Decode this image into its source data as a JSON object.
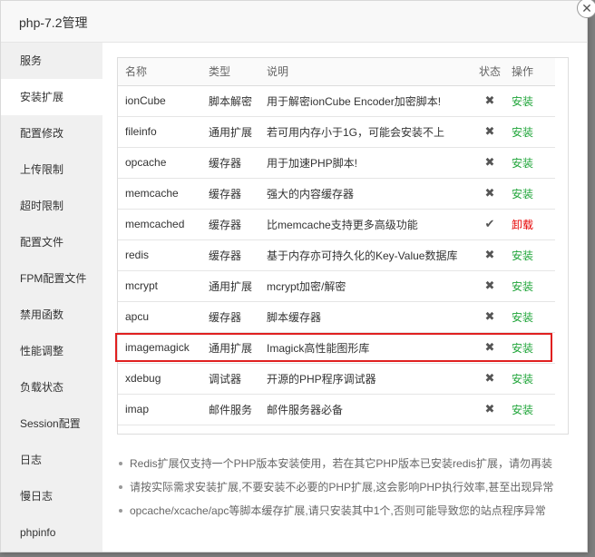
{
  "dialog": {
    "title": "php-7.2管理",
    "close_glyph": "✕"
  },
  "sidebar": {
    "items": [
      {
        "label": "服务"
      },
      {
        "label": "安装扩展",
        "active": true
      },
      {
        "label": "配置修改"
      },
      {
        "label": "上传限制"
      },
      {
        "label": "超时限制"
      },
      {
        "label": "配置文件"
      },
      {
        "label": "FPM配置文件"
      },
      {
        "label": "禁用函数"
      },
      {
        "label": "性能调整"
      },
      {
        "label": "负载状态"
      },
      {
        "label": "Session配置"
      },
      {
        "label": "日志"
      },
      {
        "label": "慢日志"
      },
      {
        "label": "phpinfo"
      }
    ]
  },
  "table": {
    "headers": {
      "name": "名称",
      "type": "类型",
      "desc": "说明",
      "status": "状态",
      "op": "操作"
    },
    "rows": [
      {
        "name": "ionCube",
        "type": "脚本解密",
        "desc": "用于解密ionCube Encoder加密脚本!",
        "status": "✖",
        "op": "安装",
        "installed": false
      },
      {
        "name": "fileinfo",
        "type": "通用扩展",
        "desc": "若可用内存小于1G，可能会安装不上",
        "status": "✖",
        "op": "安装",
        "installed": false
      },
      {
        "name": "opcache",
        "type": "缓存器",
        "desc": "用于加速PHP脚本!",
        "status": "✖",
        "op": "安装",
        "installed": false
      },
      {
        "name": "memcache",
        "type": "缓存器",
        "desc": "强大的内容缓存器",
        "status": "✖",
        "op": "安装",
        "installed": false
      },
      {
        "name": "memcached",
        "type": "缓存器",
        "desc": "比memcache支持更多高级功能",
        "status": "✔",
        "op": "卸载",
        "installed": true
      },
      {
        "name": "redis",
        "type": "缓存器",
        "desc": "基于内存亦可持久化的Key-Value数据库",
        "status": "✖",
        "op": "安装",
        "installed": false
      },
      {
        "name": "mcrypt",
        "type": "通用扩展",
        "desc": "mcrypt加密/解密",
        "status": "✖",
        "op": "安装",
        "installed": false
      },
      {
        "name": "apcu",
        "type": "缓存器",
        "desc": "脚本缓存器",
        "status": "✖",
        "op": "安装",
        "installed": false
      },
      {
        "name": "imagemagick",
        "type": "通用扩展",
        "desc": "Imagick高性能图形库",
        "status": "✖",
        "op": "安装",
        "installed": false,
        "highlighted": true
      },
      {
        "name": "xdebug",
        "type": "调试器",
        "desc": "开源的PHP程序调试器",
        "status": "✖",
        "op": "安装",
        "installed": false
      },
      {
        "name": "imap",
        "type": "邮件服务",
        "desc": "邮件服务器必备",
        "status": "✖",
        "op": "安装",
        "installed": false
      }
    ]
  },
  "notes": [
    "Redis扩展仅支持一个PHP版本安装使用，若在其它PHP版本已安装redis扩展，请勿再装",
    "请按实际需求安装扩展,不要安装不必要的PHP扩展,这会影响PHP执行效率,甚至出现异常",
    "opcache/xcache/apc等脚本缓存扩展,请只安装其中1个,否则可能导致您的站点程序异常"
  ],
  "colors": {
    "install": "#20a53a",
    "uninstall": "#e60000",
    "highlight_border": "#e02020"
  }
}
